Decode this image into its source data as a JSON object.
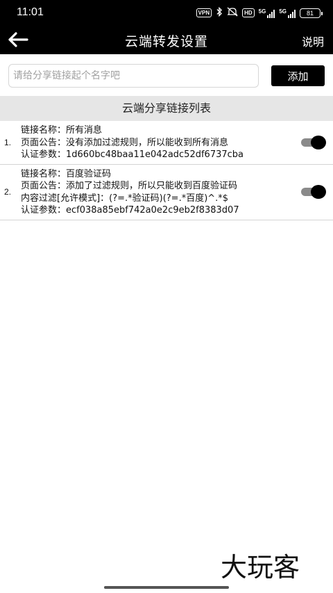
{
  "status_bar": {
    "time": "11:01",
    "vpn": "VPN",
    "hd": "HD",
    "net1": "5G",
    "net2": "5G",
    "battery": "81",
    "icons": [
      "vpn-icon",
      "bluetooth-icon",
      "mute-icon",
      "hd-icon",
      "signal-icon",
      "signal-icon",
      "battery-icon"
    ]
  },
  "app_bar": {
    "back_icon": "arrow-left-icon",
    "title": "云端转发设置",
    "help": "说明"
  },
  "form": {
    "placeholder": "请给分享链接起个名字吧",
    "value": "",
    "add_label": "添加"
  },
  "section": {
    "title": "云端分享链接列表"
  },
  "items": [
    {
      "index": "1.",
      "lines": [
        "链接名称：所有消息",
        "页面公告：没有添加过滤规则，所以能收到所有消息",
        "认证参数：1d660bc48baa11e042adc52df6737cba"
      ],
      "enabled": true
    },
    {
      "index": "2.",
      "lines": [
        "链接名称：百度验证码",
        "页面公告：添加了过滤规则，所以只能收到百度验证码",
        "内容过滤[允许模式]：(?=.*验证码)(?=.*百度)^.*$",
        "认证参数：ecf038a85ebf742a0e2c9eb2f8383d07"
      ],
      "enabled": true
    }
  ],
  "watermark": "大玩客",
  "colors": {
    "bar_bg": "#000000",
    "section_bg": "#e6e6e6",
    "toggle_track": "#8a8a8a",
    "toggle_knob": "#000000"
  }
}
